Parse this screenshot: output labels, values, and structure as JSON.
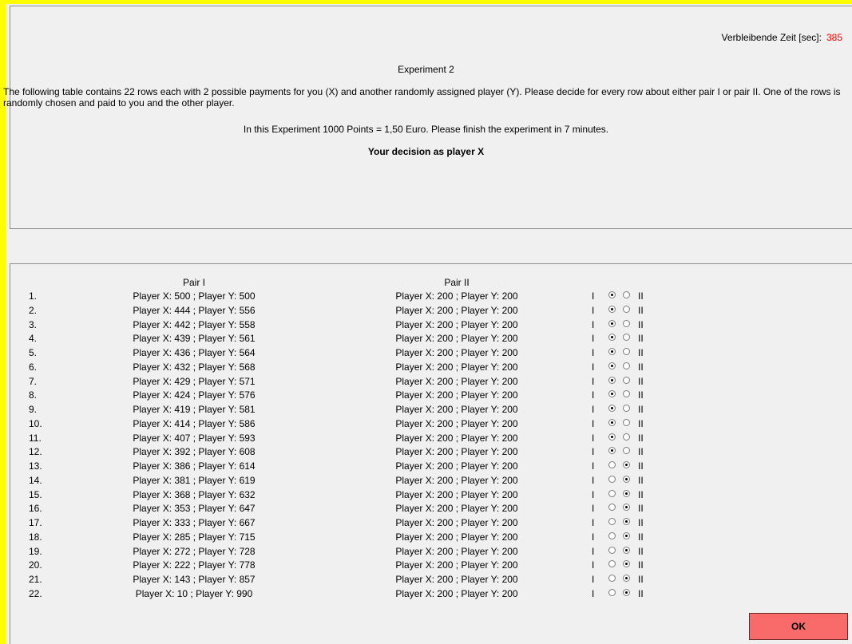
{
  "timer": {
    "label": "Verbleibende Zeit [sec]:",
    "value": "385"
  },
  "header": {
    "title": "Experiment 2",
    "description": "The following table contains 22 rows each with 2 possible payments for you (X) and another randomly assigned player (Y).  Please decide for every row about either pair I or pair II. One of the rows is randomly chosen and paid to you and the other player.",
    "points_info": "In this Experiment 1000 Points = 1,50 Euro. Please finish the experiment in 7 minutes.",
    "decision_label": "Your decision as player X"
  },
  "table": {
    "pair1_header": "Pair I",
    "pair2_header": "Pair II",
    "option_i_label": "I",
    "option_ii_label": "II",
    "rows": [
      {
        "num": "1.",
        "pair1": "Player X: 500 ; Player Y: 500",
        "pair2": "Player X: 200 ; Player Y: 200",
        "selected": "I"
      },
      {
        "num": "2.",
        "pair1": "Player X: 444 ; Player Y: 556",
        "pair2": "Player X: 200 ; Player Y: 200",
        "selected": "I"
      },
      {
        "num": "3.",
        "pair1": "Player X: 442 ; Player Y: 558",
        "pair2": "Player X: 200 ; Player Y: 200",
        "selected": "I"
      },
      {
        "num": "4.",
        "pair1": "Player X: 439 ; Player Y: 561",
        "pair2": "Player X: 200 ; Player Y: 200",
        "selected": "I"
      },
      {
        "num": "5.",
        "pair1": "Player X: 436 ; Player Y: 564",
        "pair2": "Player X: 200 ; Player Y: 200",
        "selected": "I"
      },
      {
        "num": "6.",
        "pair1": "Player X: 432 ; Player Y: 568",
        "pair2": "Player X: 200 ; Player Y: 200",
        "selected": "I"
      },
      {
        "num": "7.",
        "pair1": "Player X: 429 ; Player Y: 571",
        "pair2": "Player X: 200 ; Player Y: 200",
        "selected": "I"
      },
      {
        "num": "8.",
        "pair1": "Player X: 424 ; Player Y: 576",
        "pair2": "Player X: 200 ; Player Y: 200",
        "selected": "I"
      },
      {
        "num": "9.",
        "pair1": "Player X: 419 ; Player Y: 581",
        "pair2": "Player X: 200 ; Player Y: 200",
        "selected": "I"
      },
      {
        "num": "10.",
        "pair1": "Player X: 414 ; Player Y: 586",
        "pair2": "Player X: 200 ; Player Y: 200",
        "selected": "I"
      },
      {
        "num": "11.",
        "pair1": "Player X: 407 ; Player Y: 593",
        "pair2": "Player X: 200 ; Player Y: 200",
        "selected": "I"
      },
      {
        "num": "12.",
        "pair1": "Player X: 392 ; Player Y: 608",
        "pair2": "Player X: 200 ; Player Y: 200",
        "selected": "I"
      },
      {
        "num": "13.",
        "pair1": "Player X: 386 ; Player Y: 614",
        "pair2": "Player X: 200 ; Player Y: 200",
        "selected": "II"
      },
      {
        "num": "14.",
        "pair1": "Player X: 381 ; Player Y: 619",
        "pair2": "Player X: 200 ; Player Y: 200",
        "selected": "II"
      },
      {
        "num": "15.",
        "pair1": "Player X: 368 ; Player Y: 632",
        "pair2": "Player X: 200 ; Player Y: 200",
        "selected": "II"
      },
      {
        "num": "16.",
        "pair1": "Player X: 353 ; Player Y: 647",
        "pair2": "Player X: 200 ; Player Y: 200",
        "selected": "II"
      },
      {
        "num": "17.",
        "pair1": "Player X: 333 ; Player Y: 667",
        "pair2": "Player X: 200 ; Player Y: 200",
        "selected": "II"
      },
      {
        "num": "18.",
        "pair1": "Player X: 285 ; Player Y: 715",
        "pair2": "Player X: 200 ; Player Y: 200",
        "selected": "II"
      },
      {
        "num": "19.",
        "pair1": "Player X: 272 ; Player Y: 728",
        "pair2": "Player X: 200 ; Player Y: 200",
        "selected": "II"
      },
      {
        "num": "20.",
        "pair1": "Player X: 222 ; Player Y: 778",
        "pair2": "Player X: 200 ; Player Y: 200",
        "selected": "II"
      },
      {
        "num": "21.",
        "pair1": "Player X: 143 ; Player Y: 857",
        "pair2": "Player X: 200 ; Player Y: 200",
        "selected": "II"
      },
      {
        "num": "22.",
        "pair1": "Player X: 10 ; Player Y: 990",
        "pair2": "Player X: 200 ; Player Y: 200",
        "selected": "II"
      }
    ]
  },
  "ok_button": {
    "label": "OK",
    "color": "#f96a6a"
  },
  "colors": {
    "frame": "#ffff00",
    "timer_value": "#ff0000",
    "background": "#f0f0f0"
  }
}
